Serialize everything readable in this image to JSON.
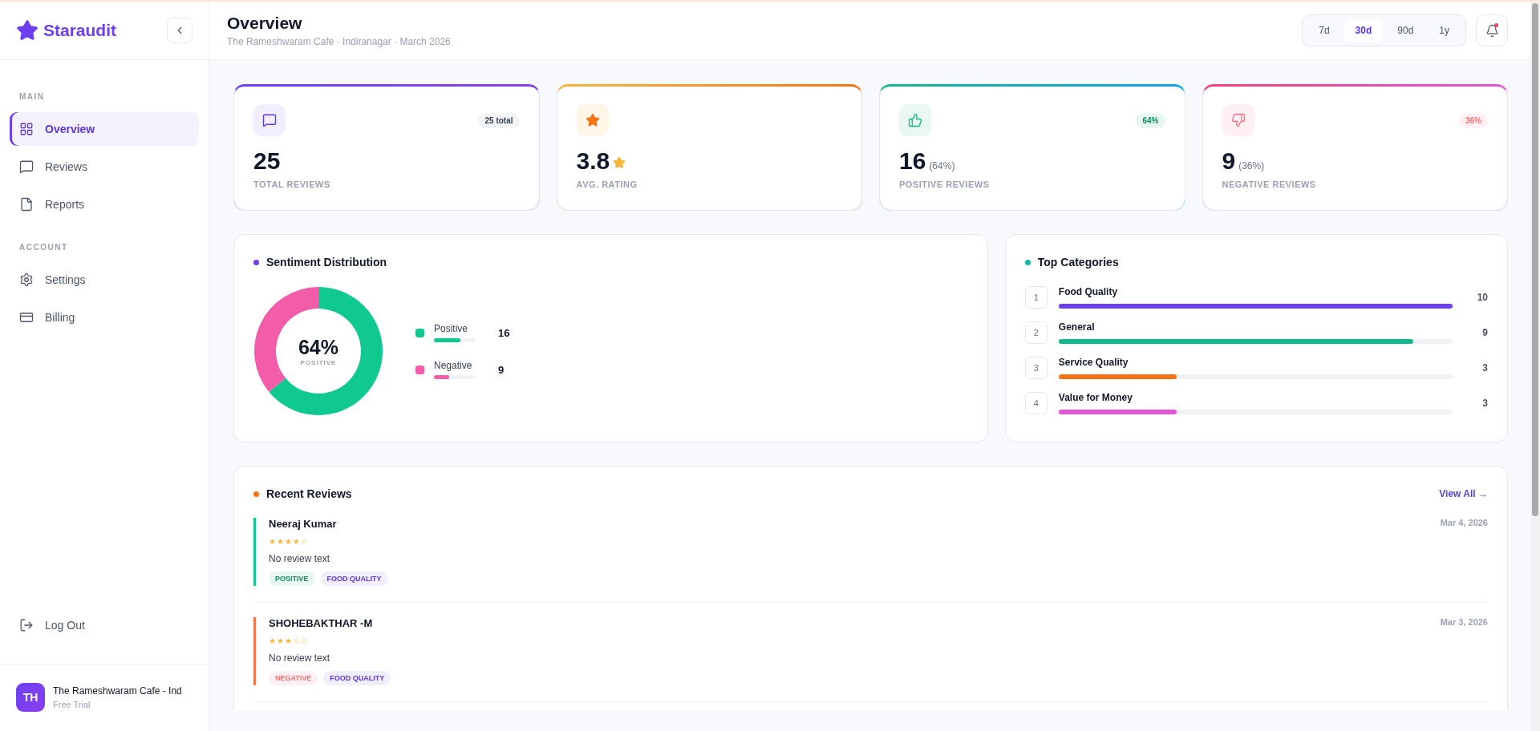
{
  "sidebar": {
    "brand": "Staraudit",
    "sections": [
      {
        "heading": "MAIN",
        "items": [
          {
            "label": "Overview",
            "selected": true
          },
          {
            "label": "Reviews",
            "selected": false
          },
          {
            "label": "Reports",
            "selected": false
          }
        ]
      },
      {
        "heading": "ACCOUNT",
        "items": [
          {
            "label": "Settings",
            "selected": false
          },
          {
            "label": "Billing",
            "selected": false
          }
        ]
      }
    ],
    "logout": "Log Out",
    "account": {
      "initials": "TH",
      "name": "The Rameshwaram Cafe - Ind",
      "plan": "Free Trial"
    }
  },
  "header": {
    "title": "Overview",
    "subtitle": "The Rameshwaram Cafe · Indiranagar · March 2026",
    "ranges": [
      {
        "label": "7d",
        "selected": false
      },
      {
        "label": "30d",
        "selected": true
      },
      {
        "label": "90d",
        "selected": false
      },
      {
        "label": "1y",
        "selected": false
      }
    ]
  },
  "stats": [
    {
      "kind": "total",
      "value": "25",
      "badge": "25 total",
      "label": "TOTAL REVIEWS"
    },
    {
      "kind": "rating",
      "value": "3.8",
      "label": "AVG. RATING"
    },
    {
      "kind": "positive",
      "value": "16",
      "suffix": "(64%)",
      "badge": "64%",
      "label": "POSITIVE REVIEWS"
    },
    {
      "kind": "negative",
      "value": "9",
      "suffix": "(36%)",
      "badge": "36%",
      "label": "NEGATIVE REVIEWS"
    }
  ],
  "sentiment": {
    "title": "Sentiment Distribution",
    "center_value": "64%",
    "center_label": "POSITIVE",
    "chart_data": {
      "type": "donut",
      "categories": [
        "Positive",
        "Negative"
      ],
      "values": [
        64,
        36
      ]
    },
    "legend": [
      {
        "count": "16",
        "level": 0.64,
        "color": "#10c98f"
      },
      {
        "count": "9",
        "level": 0.36,
        "color": "#f25ca8"
      }
    ]
  },
  "categories": {
    "title": "Top Categories",
    "items": [
      {
        "rank": "1",
        "name": "Food Quality",
        "count": "10",
        "level": 1.0,
        "color": "#6d3ff0"
      },
      {
        "rank": "2",
        "name": "General",
        "count": "9",
        "level": 0.9,
        "color": "#10b98f"
      },
      {
        "rank": "3",
        "name": "Service Quality",
        "count": "3",
        "level": 0.3,
        "color": "#f97316"
      },
      {
        "rank": "4",
        "name": "Value for Money",
        "count": "3",
        "level": 0.3,
        "color": "#e455d8"
      }
    ]
  },
  "reviews": {
    "title": "Recent Reviews",
    "view_all": "View All →",
    "items": [
      {
        "name": "Neeraj Kumar",
        "stars": 4,
        "date": "Mar 4, 2026",
        "text": "No review text",
        "sentiment": "POSITIVE",
        "category": "FOOD QUALITY",
        "kind": "positive"
      },
      {
        "name": "SHOHEBAKTHAR -M",
        "stars": 3,
        "date": "Mar 3, 2026",
        "text": "No review text",
        "sentiment": "NEGATIVE",
        "category": "FOOD QUALITY",
        "kind": "negative"
      }
    ]
  }
}
